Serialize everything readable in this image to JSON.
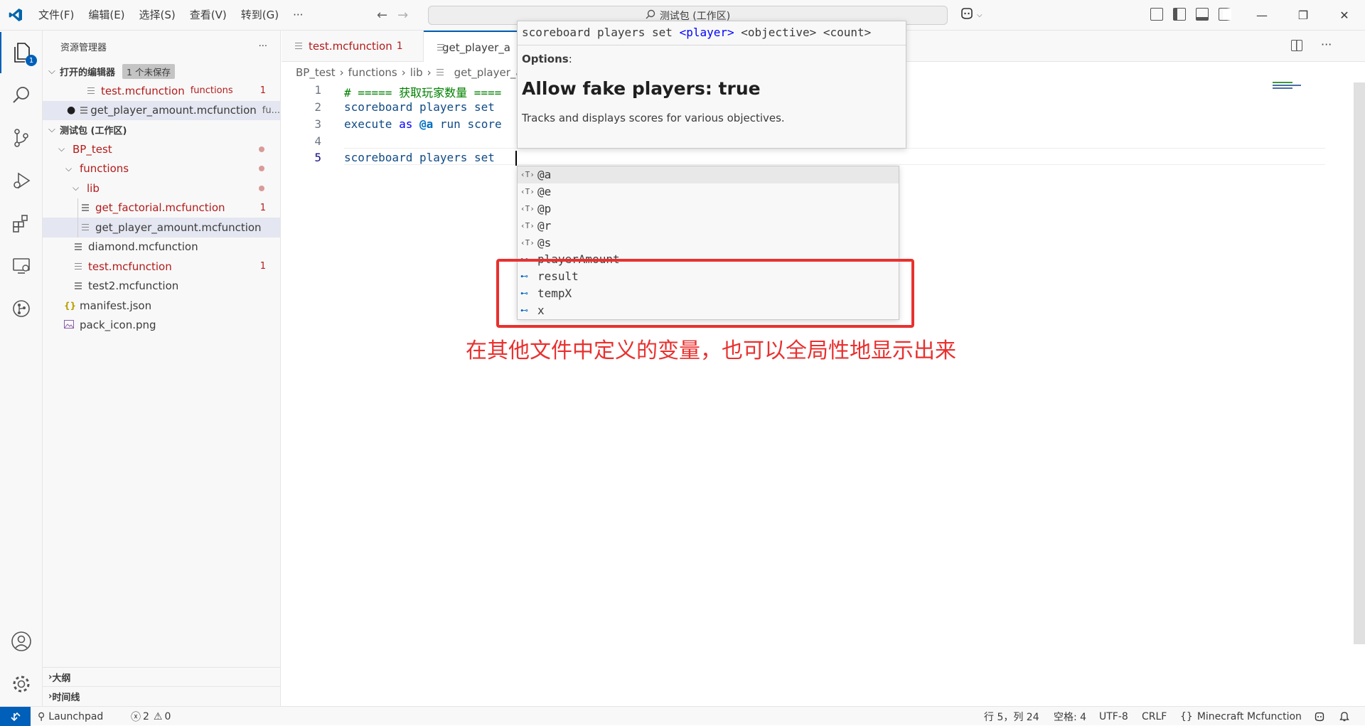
{
  "menu": [
    "文件(F)",
    "编辑(E)",
    "选择(S)",
    "查看(V)",
    "转到(G)",
    "···"
  ],
  "search_text": "测试包 (工作区)",
  "activity_badge": "1",
  "sidebar": {
    "title": "资源管理器",
    "more": "···",
    "open_editors_label": "打开的编辑器",
    "unsaved_label": "1 个未保存",
    "open_editors": [
      {
        "name": "test.mcfunction",
        "folder": "functions",
        "count": "1"
      },
      {
        "name": "get_player_amount.mcfunction",
        "folder": "fu..."
      }
    ],
    "workspace_label": "测试包 (工作区)",
    "tree": {
      "bp": "BP_test",
      "functions": "functions",
      "lib": "lib",
      "get_factorial": "get_factorial.mcfunction",
      "get_factorial_count": "1",
      "get_player_amount": "get_player_amount.mcfunction",
      "diamond": "diamond.mcfunction",
      "test": "test.mcfunction",
      "test_count": "1",
      "test2": "test2.mcfunction",
      "manifest": "manifest.json",
      "pack_icon": "pack_icon.png"
    },
    "outline_label": "大纲",
    "timeline_label": "时间线"
  },
  "tabs": [
    {
      "label": "test.mcfunction",
      "count": "1"
    },
    {
      "label": "get_player_a"
    }
  ],
  "breadcrumb": [
    "BP_test",
    "functions",
    "lib",
    "get_player_a"
  ],
  "editor": {
    "line_numbers": [
      "1",
      "2",
      "3",
      "4",
      "5"
    ],
    "line1_comment": "# ===== 获取玩家数量 ====",
    "line2": "scoreboard players set",
    "line3_cmd": "execute",
    "line3_as": "as",
    "line3_sel": "@a",
    "line3_run": "run",
    "line3_rest": "score",
    "line5": "scoreboard players set"
  },
  "hover": {
    "sig_prefix": "scoreboard players set ",
    "sig_param": "<player>",
    "sig_suffix": " <objective> <count>",
    "options_label": "Options",
    "options_colon": ":",
    "heading": "Allow fake players: true",
    "description": "Tracks and displays scores for various objectives."
  },
  "suggestions": [
    {
      "icon": "T",
      "label": "@a"
    },
    {
      "icon": "T",
      "label": "@e"
    },
    {
      "icon": "T",
      "label": "@p"
    },
    {
      "icon": "T",
      "label": "@r"
    },
    {
      "icon": "T",
      "label": "@s"
    },
    {
      "icon": "var",
      "label": "playerAmount"
    },
    {
      "icon": "var",
      "label": "result"
    },
    {
      "icon": "var",
      "label": "tempX"
    },
    {
      "icon": "var",
      "label": "x"
    }
  ],
  "annotation": "在其他文件中定义的变量，也可以全局性地显示出来",
  "statusbar": {
    "launchpad": "Launchpad",
    "errors": "2",
    "warnings": "0",
    "position": "行 5，列 24",
    "spaces": "空格: 4",
    "encoding": "UTF-8",
    "eol": "CRLF",
    "language": "Minecraft Mcfunction"
  },
  "colors": {
    "accent": "#005fb8",
    "annotation": "#e8312f",
    "error": "#b31b1b"
  }
}
